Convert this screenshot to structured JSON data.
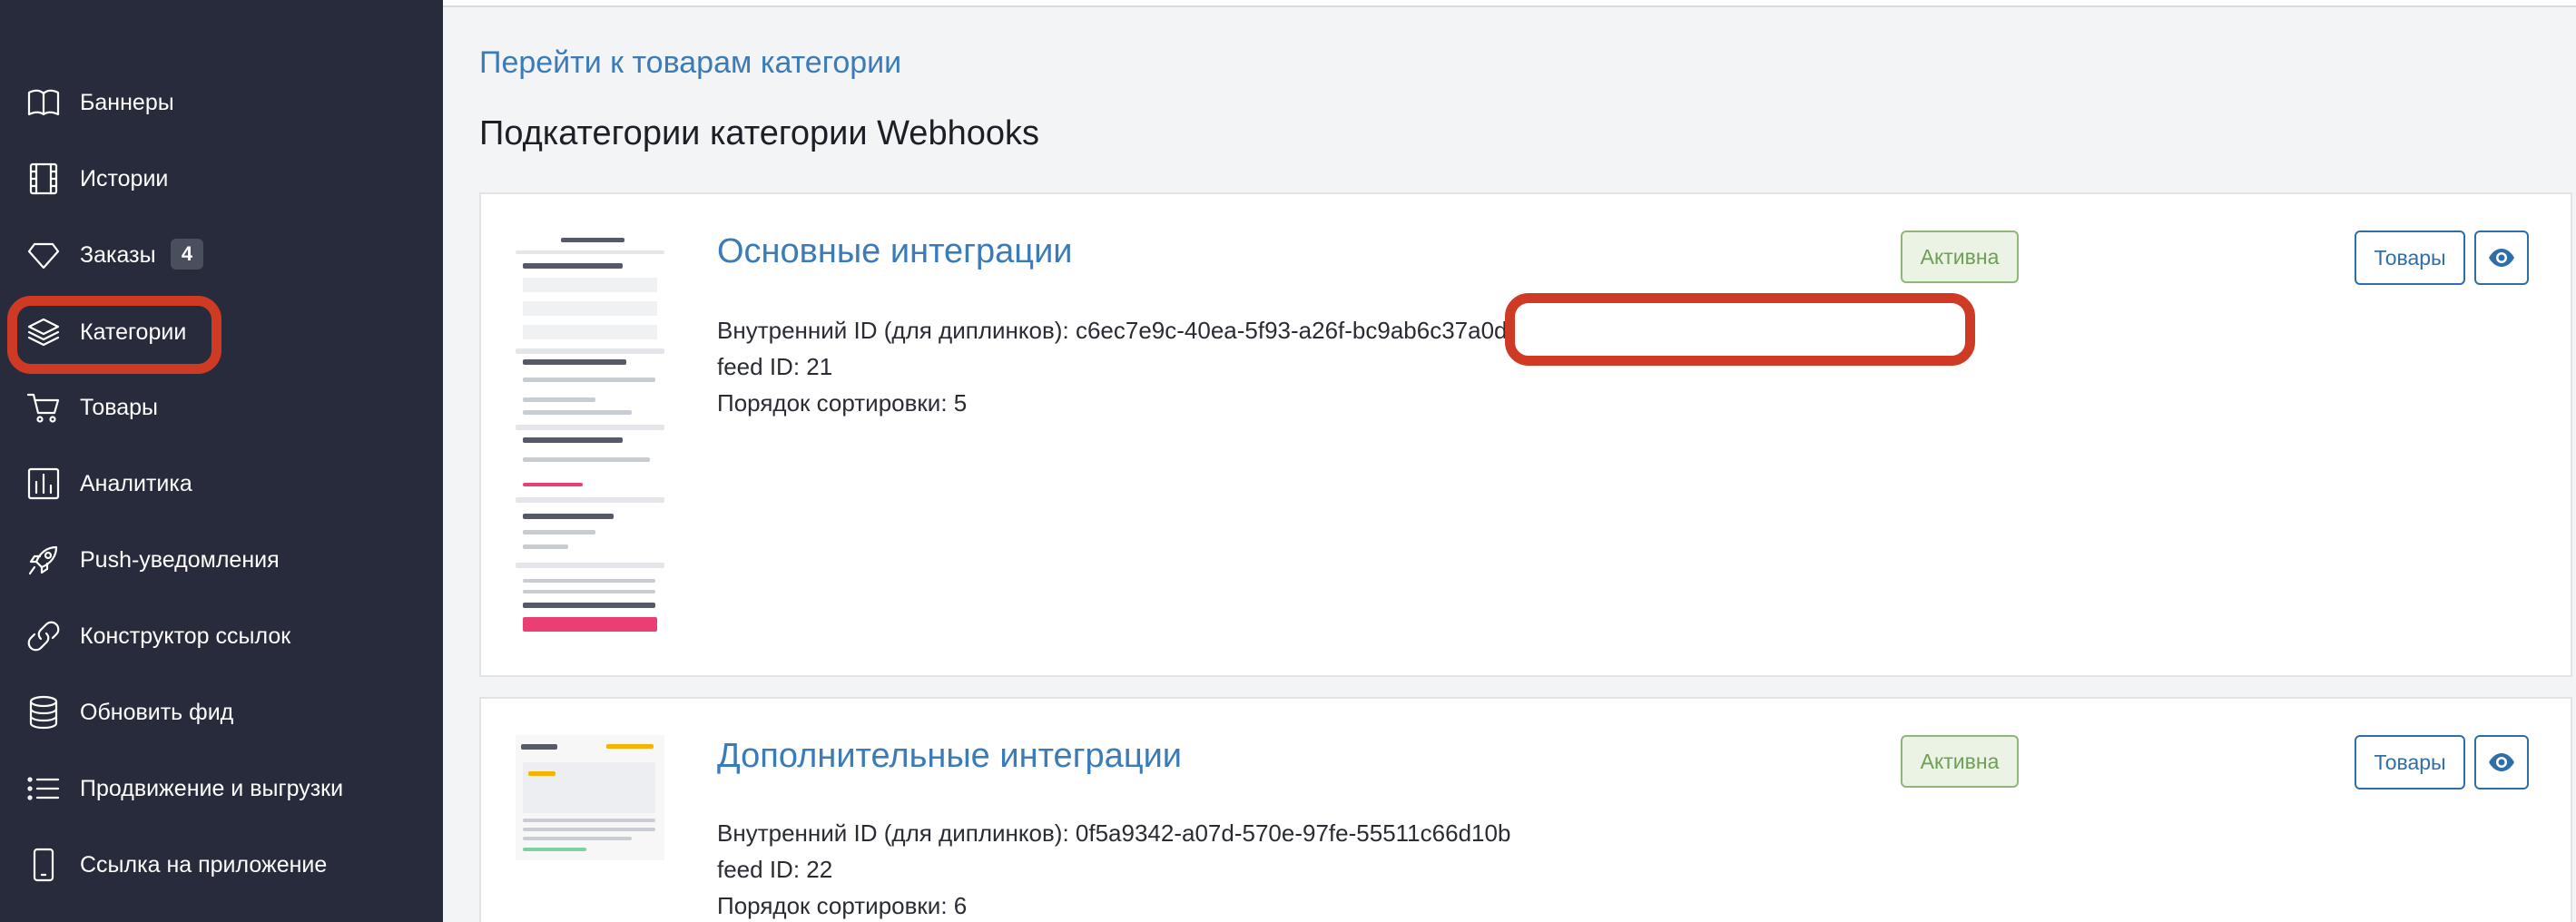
{
  "sidebar": {
    "items": [
      {
        "label": "Баннеры",
        "icon": "book-icon"
      },
      {
        "label": "Истории",
        "icon": "film-icon"
      },
      {
        "label": "Заказы",
        "icon": "diamond-icon",
        "badge": "4"
      },
      {
        "label": "Категории",
        "icon": "layers-icon"
      },
      {
        "label": "Товары",
        "icon": "cart-icon"
      },
      {
        "label": "Аналитика",
        "icon": "bar-chart-icon"
      },
      {
        "label": "Push-уведомления",
        "icon": "rocket-icon"
      },
      {
        "label": "Конструктор ссылок",
        "icon": "link-icon"
      },
      {
        "label": "Обновить фид",
        "icon": "database-icon"
      },
      {
        "label": "Продвижение и выгрузки",
        "icon": "list-icon"
      },
      {
        "label": "Ссылка на приложение",
        "icon": "smartphone-icon"
      }
    ]
  },
  "main": {
    "goto_link": "Перейти к товарам категории",
    "section_title": "Подкатегории категории Webhooks",
    "cards": [
      {
        "title": "Основные интеграции",
        "id_label": "Внутренний ID (для диплинков)",
        "id_value": "c6ec7e9c-40ea-5f93-a26f-bc9ab6c37a0d",
        "feed_id": "feed ID: 21",
        "sort": "Порядок сортировки: 5",
        "status": "Активна",
        "goods_button": "Товары"
      },
      {
        "title": "Дополнительные интеграции",
        "id_line": "Внутренний ID (для диплинков): 0f5a9342-a07d-570e-97fe-55511c66d10b",
        "feed_id": "feed ID: 22",
        "sort": "Порядок сортировки: 6",
        "status": "Активна",
        "goods_button": "Товары"
      }
    ]
  },
  "colors": {
    "sidebar_bg": "#272b3b",
    "link": "#3a7bb8",
    "highlight": "#cf3a24",
    "active_badge_bg": "#eaf3e4",
    "active_badge_text": "#6e9e58"
  }
}
